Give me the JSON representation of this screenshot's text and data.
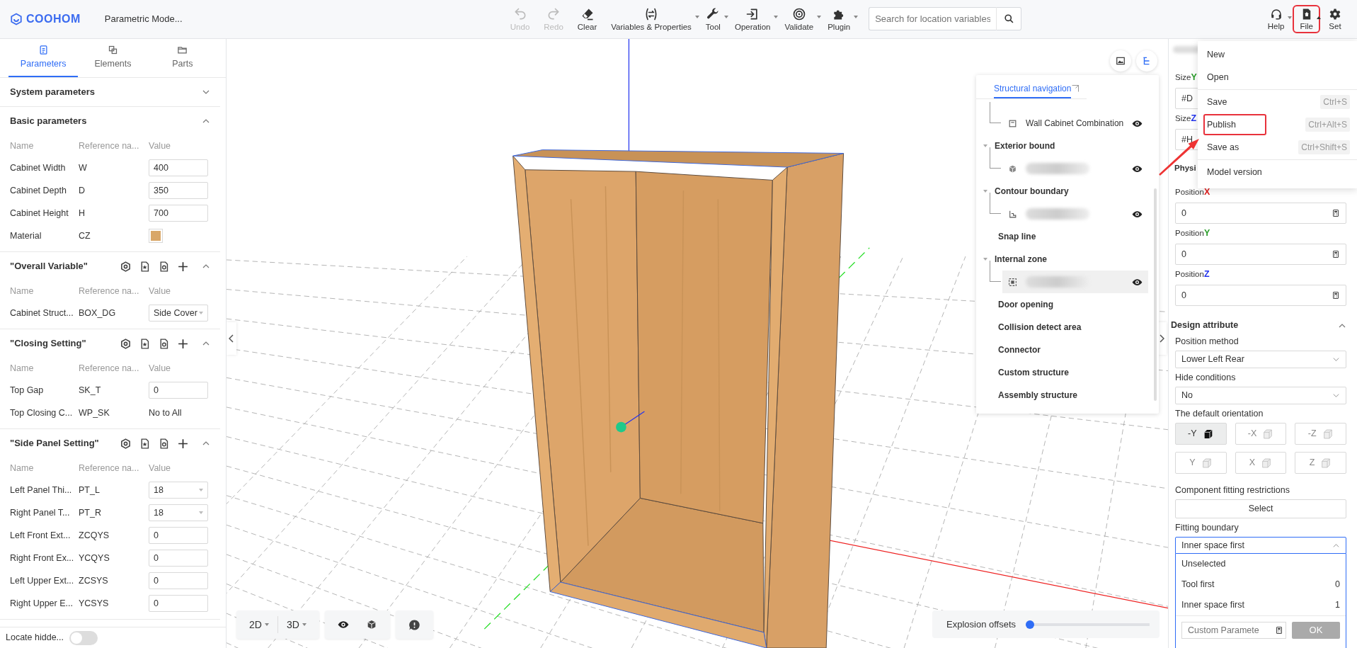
{
  "app": {
    "logo": "COOHOM",
    "title": "Parametric Mode..."
  },
  "toolbar": [
    {
      "label": "Undo",
      "disabled": true,
      "dropdown": false
    },
    {
      "label": "Redo",
      "disabled": true,
      "dropdown": false
    },
    {
      "label": "Clear",
      "disabled": false,
      "dropdown": false
    },
    {
      "label": "Variables & Properties",
      "disabled": false,
      "dropdown": true
    },
    {
      "label": "Tool",
      "disabled": false,
      "dropdown": true
    },
    {
      "label": "Operation",
      "disabled": false,
      "dropdown": true
    },
    {
      "label": "Validate",
      "disabled": false,
      "dropdown": true
    },
    {
      "label": "Plugin",
      "disabled": false,
      "dropdown": true
    }
  ],
  "search": {
    "placeholder": "Search for location variables"
  },
  "right_tools": [
    {
      "label": "Help",
      "dropdown": true,
      "highlighted": false
    },
    {
      "label": "File",
      "dropdown": true,
      "highlighted": true
    },
    {
      "label": "Set",
      "dropdown": false,
      "highlighted": false
    }
  ],
  "file_menu": [
    {
      "items": [
        {
          "label": "New",
          "highlighted": false
        },
        {
          "label": "Open",
          "highlighted": false
        }
      ]
    },
    {
      "items": [
        {
          "label": "Save",
          "shortcut": "Ctrl+S",
          "highlighted": false
        },
        {
          "label": "Publish",
          "shortcut": "Ctrl+Alt+S",
          "highlighted": true
        },
        {
          "label": "Save as",
          "shortcut": "Ctrl+Shift+S",
          "highlighted": false
        }
      ]
    },
    {
      "items": [
        {
          "label": "Model version",
          "highlighted": false
        }
      ]
    }
  ],
  "left_tabs": [
    {
      "label": "Parameters",
      "selected": true
    },
    {
      "label": "Elements",
      "selected": false
    },
    {
      "label": "Parts",
      "selected": false
    }
  ],
  "sections": [
    {
      "title": "System parameters",
      "expanded": false,
      "tools": false
    },
    {
      "title": "Basic parameters",
      "expanded": true,
      "tools": false,
      "columns": [
        "Name",
        "Reference na...",
        "Value"
      ],
      "rows": [
        {
          "name": "Cabinet Width",
          "ref": "W",
          "kind": "input",
          "value": "400"
        },
        {
          "name": "Cabinet Depth",
          "ref": "D",
          "kind": "input",
          "value": "350"
        },
        {
          "name": "Cabinet Height",
          "ref": "H",
          "kind": "input",
          "value": "700"
        },
        {
          "name": "Material",
          "ref": "CZ",
          "kind": "swatch"
        }
      ]
    },
    {
      "title": "\"Overall Variable\"",
      "expanded": true,
      "tools": true,
      "columns": [
        "Name",
        "Reference na...",
        "Value"
      ],
      "rows": [
        {
          "name": "Cabinet Struct...",
          "ref": "BOX_DG",
          "kind": "select",
          "value": "Side Cover"
        }
      ]
    },
    {
      "title": "\"Closing Setting\"",
      "expanded": true,
      "tools": true,
      "columns": [
        "Name",
        "Reference na...",
        "Value"
      ],
      "rows": [
        {
          "name": "Top Gap",
          "ref": "SK_T",
          "kind": "input",
          "value": "0"
        },
        {
          "name": "Top Closing C...",
          "ref": "WP_SK",
          "kind": "text",
          "value": "No to All"
        }
      ]
    },
    {
      "title": "\"Side Panel Setting\"",
      "expanded": true,
      "tools": true,
      "columns": [
        "Name",
        "Reference na...",
        "Value"
      ],
      "rows": [
        {
          "name": "Left Panel Thi...",
          "ref": "PT_L",
          "kind": "select",
          "value": "18"
        },
        {
          "name": "Right Panel T...",
          "ref": "PT_R",
          "kind": "select",
          "value": "18"
        },
        {
          "name": "Left Front Ext...",
          "ref": "ZCQYS",
          "kind": "input",
          "value": "0"
        },
        {
          "name": "Right Front Ex...",
          "ref": "YCQYS",
          "kind": "input",
          "value": "0"
        },
        {
          "name": "Left Upper Ext...",
          "ref": "ZCSYS",
          "kind": "input",
          "value": "0"
        },
        {
          "name": "Right Upper E...",
          "ref": "YCSYS",
          "kind": "input",
          "value": "0"
        }
      ]
    }
  ],
  "locate_hidden": {
    "label": "Locate hidde...",
    "on": false
  },
  "nav": {
    "tabs": [
      {
        "label": "Structural navigation",
        "selected": true
      }
    ],
    "groups": [
      {
        "children": [
          {
            "label": "Wall Cabinet Combination",
            "selected": false
          }
        ]
      },
      {
        "title": "Exterior bound",
        "expanded": true,
        "children": [
          {
            "selected": false
          }
        ]
      },
      {
        "title": "Contour boundary",
        "expanded": true,
        "children": [
          {
            "selected": false
          }
        ]
      },
      {
        "title": "Snap line"
      },
      {
        "title": "Internal zone",
        "expanded": true,
        "children": [
          {
            "selected": true
          }
        ]
      },
      {
        "title": "Door opening"
      },
      {
        "title": "Collision detect area"
      },
      {
        "title": "Connector"
      },
      {
        "title": "Custom structure"
      },
      {
        "title": "Assembly structure"
      }
    ]
  },
  "view_toolbar": {
    "modes": [
      {
        "label": "2D",
        "dropdown": true
      },
      {
        "label": "3D",
        "dropdown": true
      }
    ]
  },
  "explosion": {
    "label": "Explosion offsets",
    "level": 0
  },
  "properties": {
    "sizes": [
      {
        "label": "Size",
        "axis": "Y",
        "color": "#2a9d2a",
        "value": "#D"
      },
      {
        "label": "Size",
        "axis": "Z",
        "color": "#2233ee",
        "value": "#H"
      }
    ],
    "heading": "Physi",
    "positions": [
      {
        "label": "Position",
        "axis": "X",
        "color": "#e02020",
        "value": "0"
      },
      {
        "label": "Position",
        "axis": "Y",
        "color": "#2a9d2a",
        "value": "0"
      },
      {
        "label": "Position",
        "axis": "Z",
        "color": "#2233ee",
        "value": "0"
      }
    ]
  },
  "design": {
    "title": "Design attribute",
    "expanded": true,
    "selects": [
      {
        "label": "Position method",
        "value": "Lower Left Rear"
      },
      {
        "label": "Hide conditions",
        "value": "No"
      }
    ],
    "orientation": {
      "label": "The default orientation",
      "options": [
        {
          "label": "-Y",
          "selected": true
        },
        {
          "label": "-X",
          "selected": false
        },
        {
          "label": "-Z",
          "selected": false
        },
        {
          "label": "Y",
          "selected": false
        },
        {
          "label": "X",
          "selected": false
        },
        {
          "label": "Z",
          "selected": false
        }
      ]
    },
    "restrictions": {
      "label": "Component fitting restrictions",
      "button": "Select"
    },
    "boundary": {
      "label": "Fitting boundary",
      "value": "Inner space first",
      "expanded": true,
      "options": [
        {
          "label": "Unselected"
        },
        {
          "label": "Tool first",
          "value": "0"
        },
        {
          "label": "Inner space first",
          "value": "1"
        }
      ],
      "custom_placeholder": "Custom Paramete",
      "ok": "OK"
    }
  }
}
